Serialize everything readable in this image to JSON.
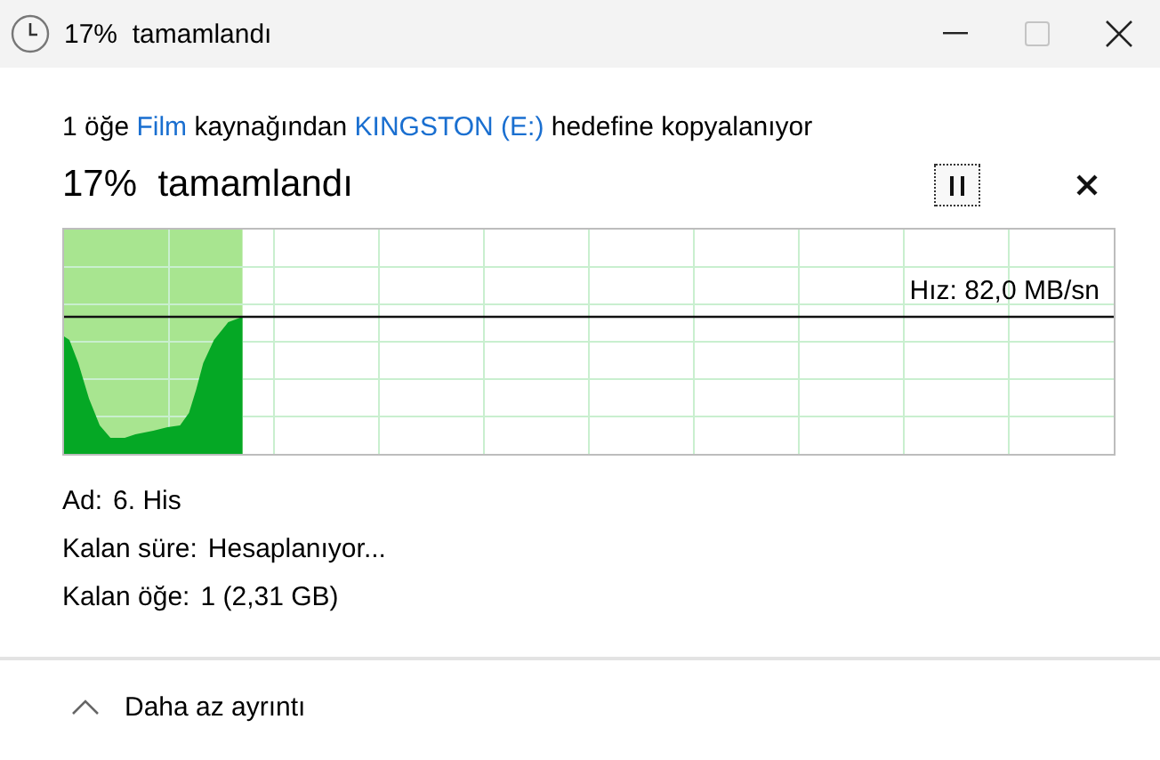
{
  "window": {
    "title": "17%  tamamlandı",
    "controls": [
      {
        "kind": "minimize",
        "disabled": false
      },
      {
        "kind": "maximize",
        "disabled": true
      },
      {
        "kind": "close",
        "disabled": false
      }
    ]
  },
  "summary": [
    {
      "kind": "text",
      "text": "1 öğe "
    },
    {
      "kind": "link",
      "text": "Film"
    },
    {
      "kind": "text",
      "text": " kaynağından "
    },
    {
      "kind": "link",
      "text": "KINGSTON (E:)"
    },
    {
      "kind": "text",
      "text": " hedefine kopyalanıyor"
    }
  ],
  "progress": {
    "heading": "17%  tamamlandı",
    "level": 0.17,
    "speed": "Hız: 82,0 MB/sn"
  },
  "details": [
    {
      "label": "Ad:",
      "value": "6. His"
    },
    {
      "label": "Kalan süre:",
      "value": "Hesaplanıyor..."
    },
    {
      "label": "Kalan öğe:",
      "value": "1 (2,31 GB)"
    }
  ],
  "footer": {
    "toggle": "Daha az ayrıntı"
  }
}
